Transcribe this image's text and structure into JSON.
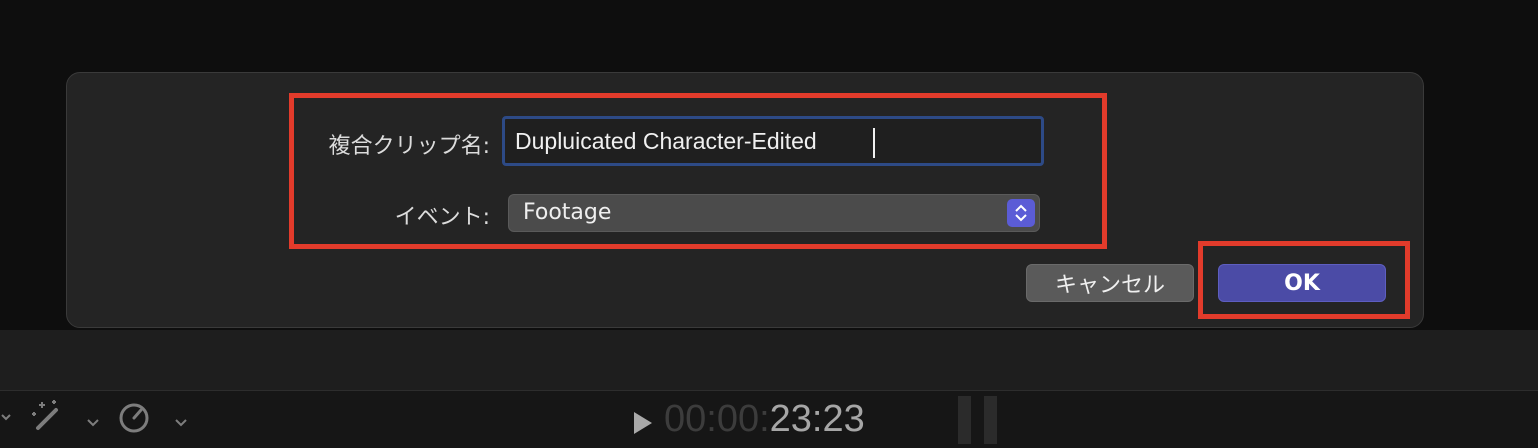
{
  "dialog": {
    "name_label": "複合クリップ名:",
    "name_value": "Dupluicated Character-Edited",
    "event_label": "イベント:",
    "event_value": "Footage",
    "cancel_label": "キャンセル",
    "ok_label": "OK"
  },
  "toolbar": {
    "timecode_dim": "00:00:",
    "timecode_bright": "23:23",
    "icons": [
      "magic-wand-icon",
      "chevron-down-icon",
      "speed-gauge-icon",
      "chevron-down-icon",
      "play-icon"
    ]
  },
  "colors": {
    "highlight_red": "#e23b2b",
    "ok_blue": "#4b4ba6",
    "focus_blue": "#2d4a86"
  }
}
